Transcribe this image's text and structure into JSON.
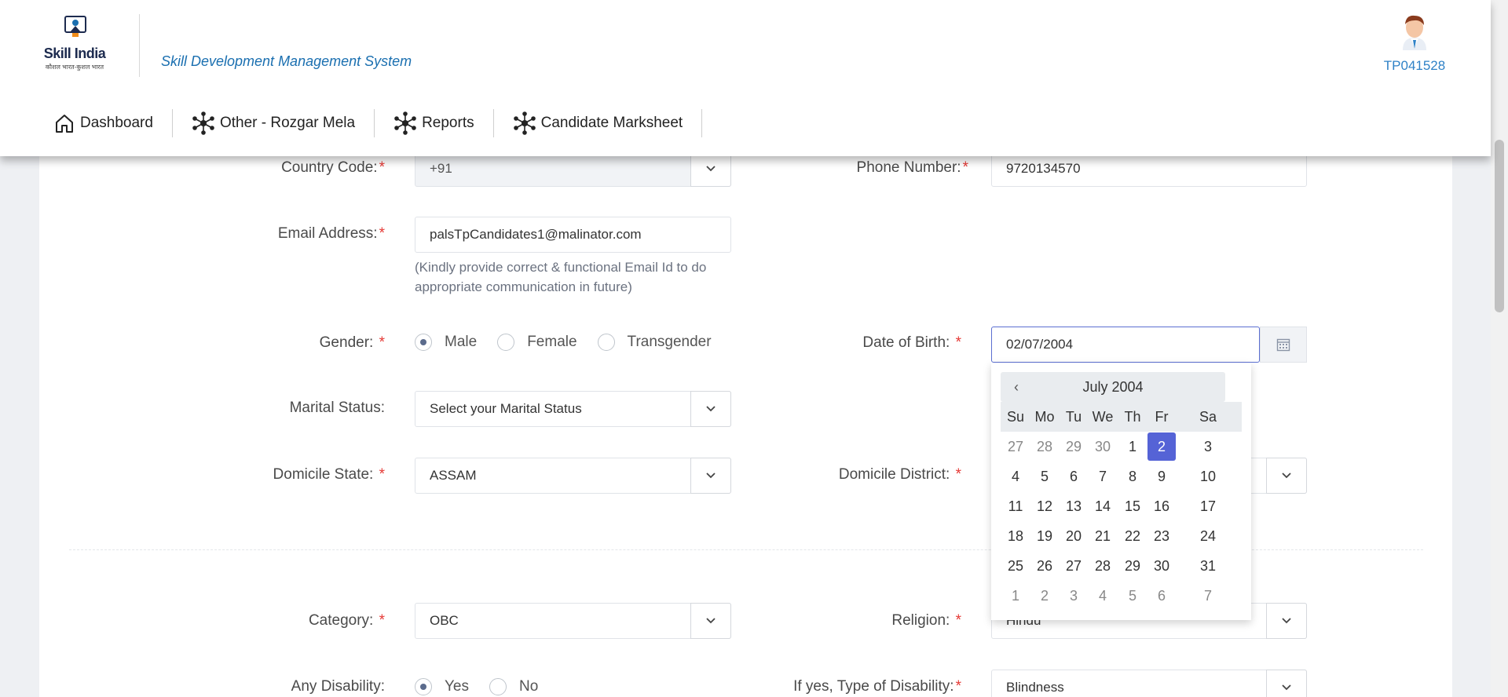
{
  "header": {
    "logo_title": "Skill India",
    "logo_sub": "कौशल भारत-कुशल भारत",
    "app_title": "Skill Development Management System",
    "user_id": "TP041528"
  },
  "nav": {
    "items": [
      {
        "label": "Dashboard",
        "icon": "home-icon"
      },
      {
        "label": "Other - Rozgar Mela",
        "icon": "network-icon"
      },
      {
        "label": "Reports",
        "icon": "network-icon"
      },
      {
        "label": "Candidate Marksheet",
        "icon": "network-icon"
      }
    ]
  },
  "form": {
    "country_code": {
      "label": "Country Code:",
      "required": "*",
      "value": "+91"
    },
    "phone": {
      "label": "Phone Number:",
      "required": "*",
      "value": "9720134570"
    },
    "email": {
      "label": "Email Address:",
      "required": "*",
      "value": "palsTpCandidates1@malinator.com",
      "hint": "(Kindly provide correct & functional Email Id to do appropriate communication in future)"
    },
    "gender": {
      "label": "Gender: ",
      "required": "*",
      "options": [
        "Male",
        "Female",
        "Transgender"
      ],
      "selected": "Male"
    },
    "dob": {
      "label": "Date of Birth: ",
      "required": "*",
      "value": "02/07/2004"
    },
    "marital": {
      "label": "Marital Status:",
      "placeholder": "Select your Marital Status"
    },
    "domicile_state": {
      "label": "Domicile State: ",
      "required": "*",
      "value": "ASSAM"
    },
    "domicile_district": {
      "label": "Domicile District: ",
      "required": "*"
    },
    "category": {
      "label": "Category: ",
      "required": "*",
      "value": "OBC"
    },
    "religion": {
      "label": "Religion: ",
      "required": "*",
      "value": "Hindu"
    },
    "disability": {
      "label": "Any Disability:",
      "options": [
        "Yes",
        "No"
      ],
      "selected": "Yes"
    },
    "disability_type": {
      "label": "If yes, Type of Disability:",
      "required": "*",
      "value": "Blindness"
    }
  },
  "datepicker": {
    "prev": "‹",
    "month_label": "July 2004",
    "weekdays": [
      "Su",
      "Mo",
      "Tu",
      "We",
      "Th",
      "Fr",
      "Sa"
    ],
    "weeks": [
      [
        "27",
        "28",
        "29",
        "30",
        "1",
        "2",
        "3"
      ],
      [
        "4",
        "5",
        "6",
        "7",
        "8",
        "9",
        "10"
      ],
      [
        "11",
        "12",
        "13",
        "14",
        "15",
        "16",
        "17"
      ],
      [
        "18",
        "19",
        "20",
        "21",
        "22",
        "23",
        "24"
      ],
      [
        "25",
        "26",
        "27",
        "28",
        "29",
        "30",
        "31"
      ],
      [
        "1",
        "2",
        "3",
        "4",
        "5",
        "6",
        "7"
      ]
    ],
    "selected_day": "2"
  }
}
